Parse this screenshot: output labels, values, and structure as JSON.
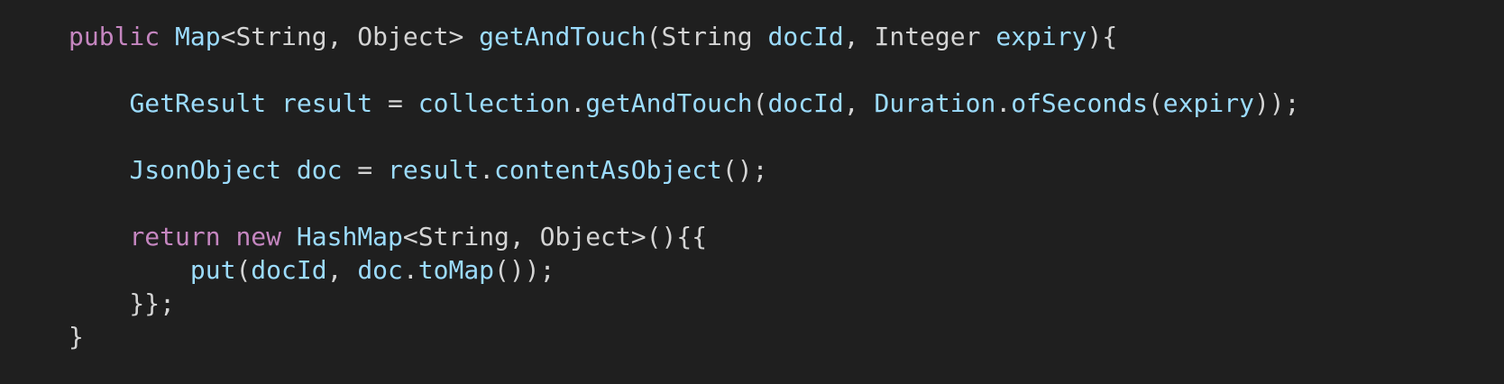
{
  "colors": {
    "background": "#1f1f1f",
    "plain": "#d4d4d4",
    "keyword": "#c586c0",
    "identifier": "#9cdcfe"
  },
  "lines": [
    [
      {
        "t": "public",
        "c": "kw"
      },
      {
        "t": " ",
        "c": "pl"
      },
      {
        "t": "Map",
        "c": "id"
      },
      {
        "t": "<String, Object> ",
        "c": "pl"
      },
      {
        "t": "getAndTouch",
        "c": "id"
      },
      {
        "t": "(String ",
        "c": "pl"
      },
      {
        "t": "docId",
        "c": "id"
      },
      {
        "t": ", Integer ",
        "c": "pl"
      },
      {
        "t": "expiry",
        "c": "id"
      },
      {
        "t": "){",
        "c": "pl"
      }
    ],
    [],
    [
      {
        "t": "    ",
        "c": "pl"
      },
      {
        "t": "GetResult",
        "c": "id"
      },
      {
        "t": " ",
        "c": "pl"
      },
      {
        "t": "result",
        "c": "id"
      },
      {
        "t": " = ",
        "c": "pl"
      },
      {
        "t": "collection",
        "c": "id"
      },
      {
        "t": ".",
        "c": "pl"
      },
      {
        "t": "getAndTouch",
        "c": "id"
      },
      {
        "t": "(",
        "c": "pl"
      },
      {
        "t": "docId",
        "c": "id"
      },
      {
        "t": ", ",
        "c": "pl"
      },
      {
        "t": "Duration",
        "c": "id"
      },
      {
        "t": ".",
        "c": "pl"
      },
      {
        "t": "ofSeconds",
        "c": "id"
      },
      {
        "t": "(",
        "c": "pl"
      },
      {
        "t": "expiry",
        "c": "id"
      },
      {
        "t": "));",
        "c": "pl"
      }
    ],
    [],
    [
      {
        "t": "    ",
        "c": "pl"
      },
      {
        "t": "JsonObject",
        "c": "id"
      },
      {
        "t": " ",
        "c": "pl"
      },
      {
        "t": "doc",
        "c": "id"
      },
      {
        "t": " = ",
        "c": "pl"
      },
      {
        "t": "result",
        "c": "id"
      },
      {
        "t": ".",
        "c": "pl"
      },
      {
        "t": "contentAsObject",
        "c": "id"
      },
      {
        "t": "();",
        "c": "pl"
      }
    ],
    [],
    [
      {
        "t": "    ",
        "c": "pl"
      },
      {
        "t": "return",
        "c": "kw"
      },
      {
        "t": " ",
        "c": "pl"
      },
      {
        "t": "new",
        "c": "kw"
      },
      {
        "t": " ",
        "c": "pl"
      },
      {
        "t": "HashMap",
        "c": "id"
      },
      {
        "t": "<String, Object>(){{",
        "c": "pl"
      }
    ],
    [
      {
        "t": "        ",
        "c": "pl"
      },
      {
        "t": "put",
        "c": "id"
      },
      {
        "t": "(",
        "c": "pl"
      },
      {
        "t": "docId",
        "c": "id"
      },
      {
        "t": ", ",
        "c": "pl"
      },
      {
        "t": "doc",
        "c": "id"
      },
      {
        "t": ".",
        "c": "pl"
      },
      {
        "t": "toMap",
        "c": "id"
      },
      {
        "t": "());",
        "c": "pl"
      }
    ],
    [
      {
        "t": "    }};",
        "c": "pl"
      }
    ],
    [
      {
        "t": "}",
        "c": "pl"
      }
    ]
  ]
}
